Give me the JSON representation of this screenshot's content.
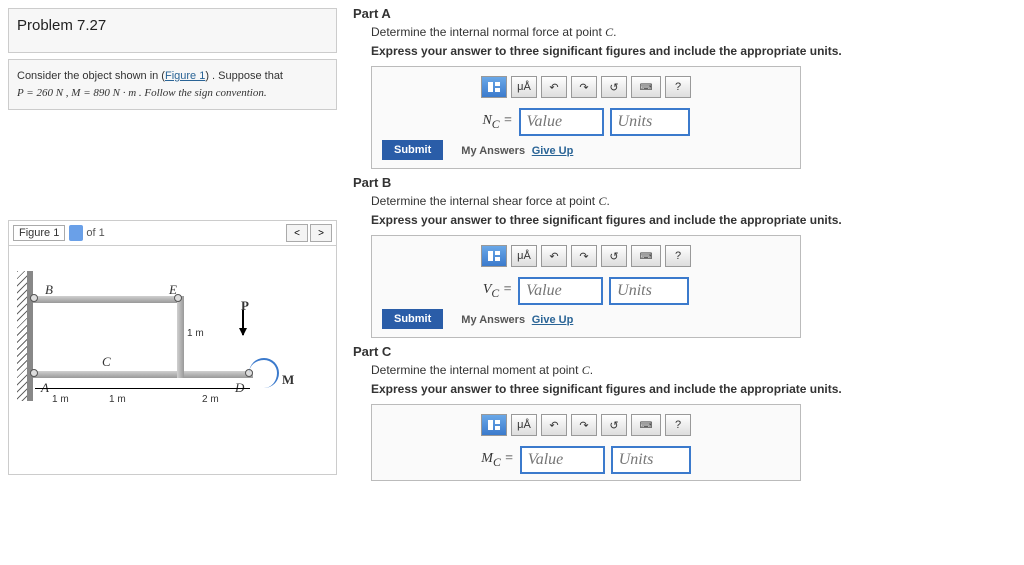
{
  "problem": {
    "title": "Problem 7.27",
    "text_before": "Consider the object shown in (",
    "figure_link": "Figure 1",
    "text_after": ") . Suppose that ",
    "givens_html": "P = 260 N , M = 890 N · m . Follow the sign convention."
  },
  "figure": {
    "label": "Figure 1",
    "of_text": "of 1",
    "prev": "<",
    "next": ">",
    "labels": {
      "B": "B",
      "E": "E",
      "P": "P",
      "C": "C",
      "A": "A",
      "D": "D",
      "M": "M"
    },
    "dims": {
      "h": "1 m",
      "d1": "1 m",
      "d2": "1 m",
      "d3": "2 m"
    }
  },
  "parts": [
    {
      "title": "Part A",
      "desc_pre": "Determine the internal normal force at point ",
      "point": "C",
      "desc_post": ".",
      "bold": "Express your answer to three significant figures and include the appropriate units.",
      "var": "N",
      "sub": "C"
    },
    {
      "title": "Part B",
      "desc_pre": "Determine the internal shear force at point ",
      "point": "C",
      "desc_post": ".",
      "bold": "Express your answer to three significant figures and include the appropriate units.",
      "var": "V",
      "sub": "C"
    },
    {
      "title": "Part C",
      "desc_pre": "Determine the internal moment at point ",
      "point": "C",
      "desc_post": ".",
      "bold": "Express your answer to three significant figures and include the appropriate units.",
      "var": "M",
      "sub": "C"
    }
  ],
  "answer": {
    "value_ph": "Value",
    "units_ph": "Units",
    "submit": "Submit",
    "my_answers": "My Answers",
    "give_up": "Give Up",
    "tool_units": "μÅ",
    "tool_q": "?",
    "eq": " = "
  }
}
